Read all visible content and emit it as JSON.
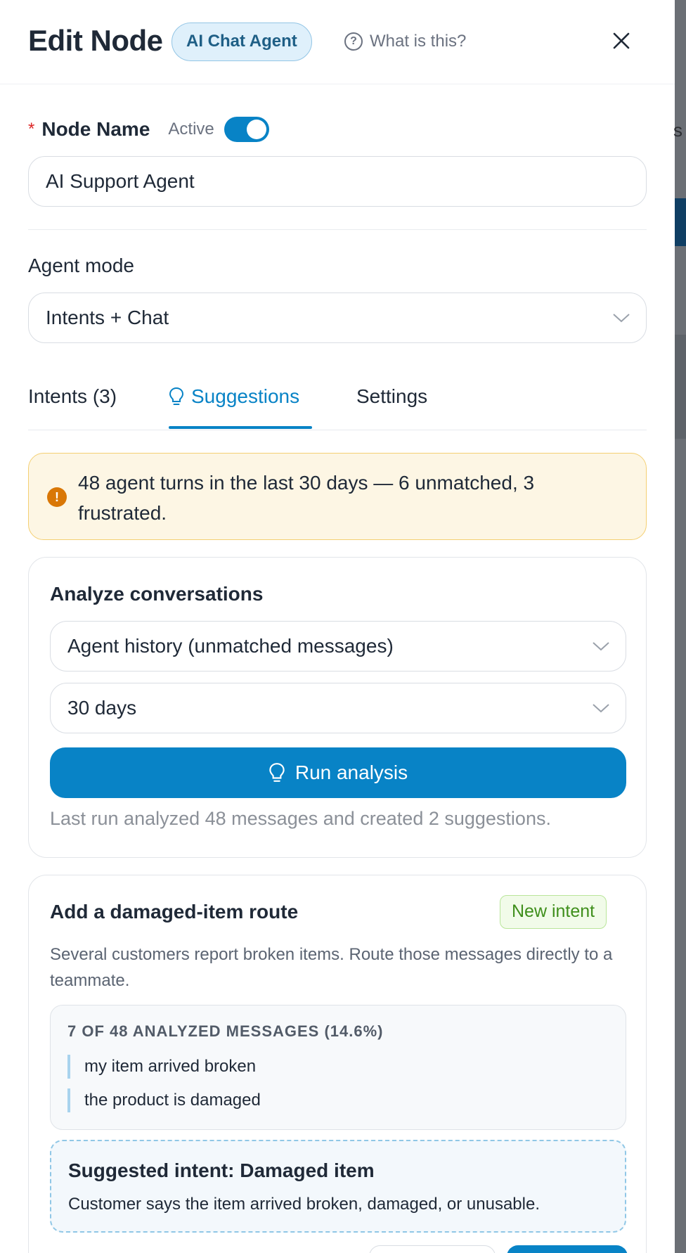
{
  "header": {
    "title": "Edit Node",
    "node_type_badge": "AI Chat Agent",
    "help_link": "What is this?"
  },
  "node_name": {
    "label": "Node Name",
    "required_marker": "*",
    "active_label": "Active",
    "active": true,
    "value": "AI Support Agent"
  },
  "agent_mode": {
    "label": "Agent mode",
    "selected": "Intents + Chat"
  },
  "tabs": [
    {
      "label": "Intents (3)",
      "active": false
    },
    {
      "label": "Suggestions",
      "active": true,
      "icon": "lightbulb-icon"
    },
    {
      "label": "Settings",
      "active": false
    }
  ],
  "alert": {
    "icon": "!",
    "text": "48 agent turns in the last 30 days — 6 unmatched, 3 frustrated."
  },
  "analyze": {
    "title": "Analyze conversations",
    "source_selected": "Agent history (unmatched messages)",
    "period_selected": "30 days",
    "run_label": "Run analysis",
    "last_run": "Last run analyzed 48 messages and created 2 suggestions."
  },
  "suggestion": {
    "title": "Add a damaged-item route",
    "badge": "New intent",
    "description": "Several customers report broken items. Route those messages directly to a teammate.",
    "evidence_header": "7 OF 48 ANALYZED MESSAGES (14.6%)",
    "quotes": [
      "my item arrived broken",
      "the product is damaged"
    ],
    "intent_title": "Suggested intent: Damaged item",
    "intent_description": "Customer says the item arrived broken, damaged, or unusable."
  },
  "colors": {
    "accent": "#0883c6",
    "warning_bg": "#fdf6e4",
    "warning_border": "#f4cf72",
    "success": "#3f8f1c",
    "required": "#dc2626"
  }
}
